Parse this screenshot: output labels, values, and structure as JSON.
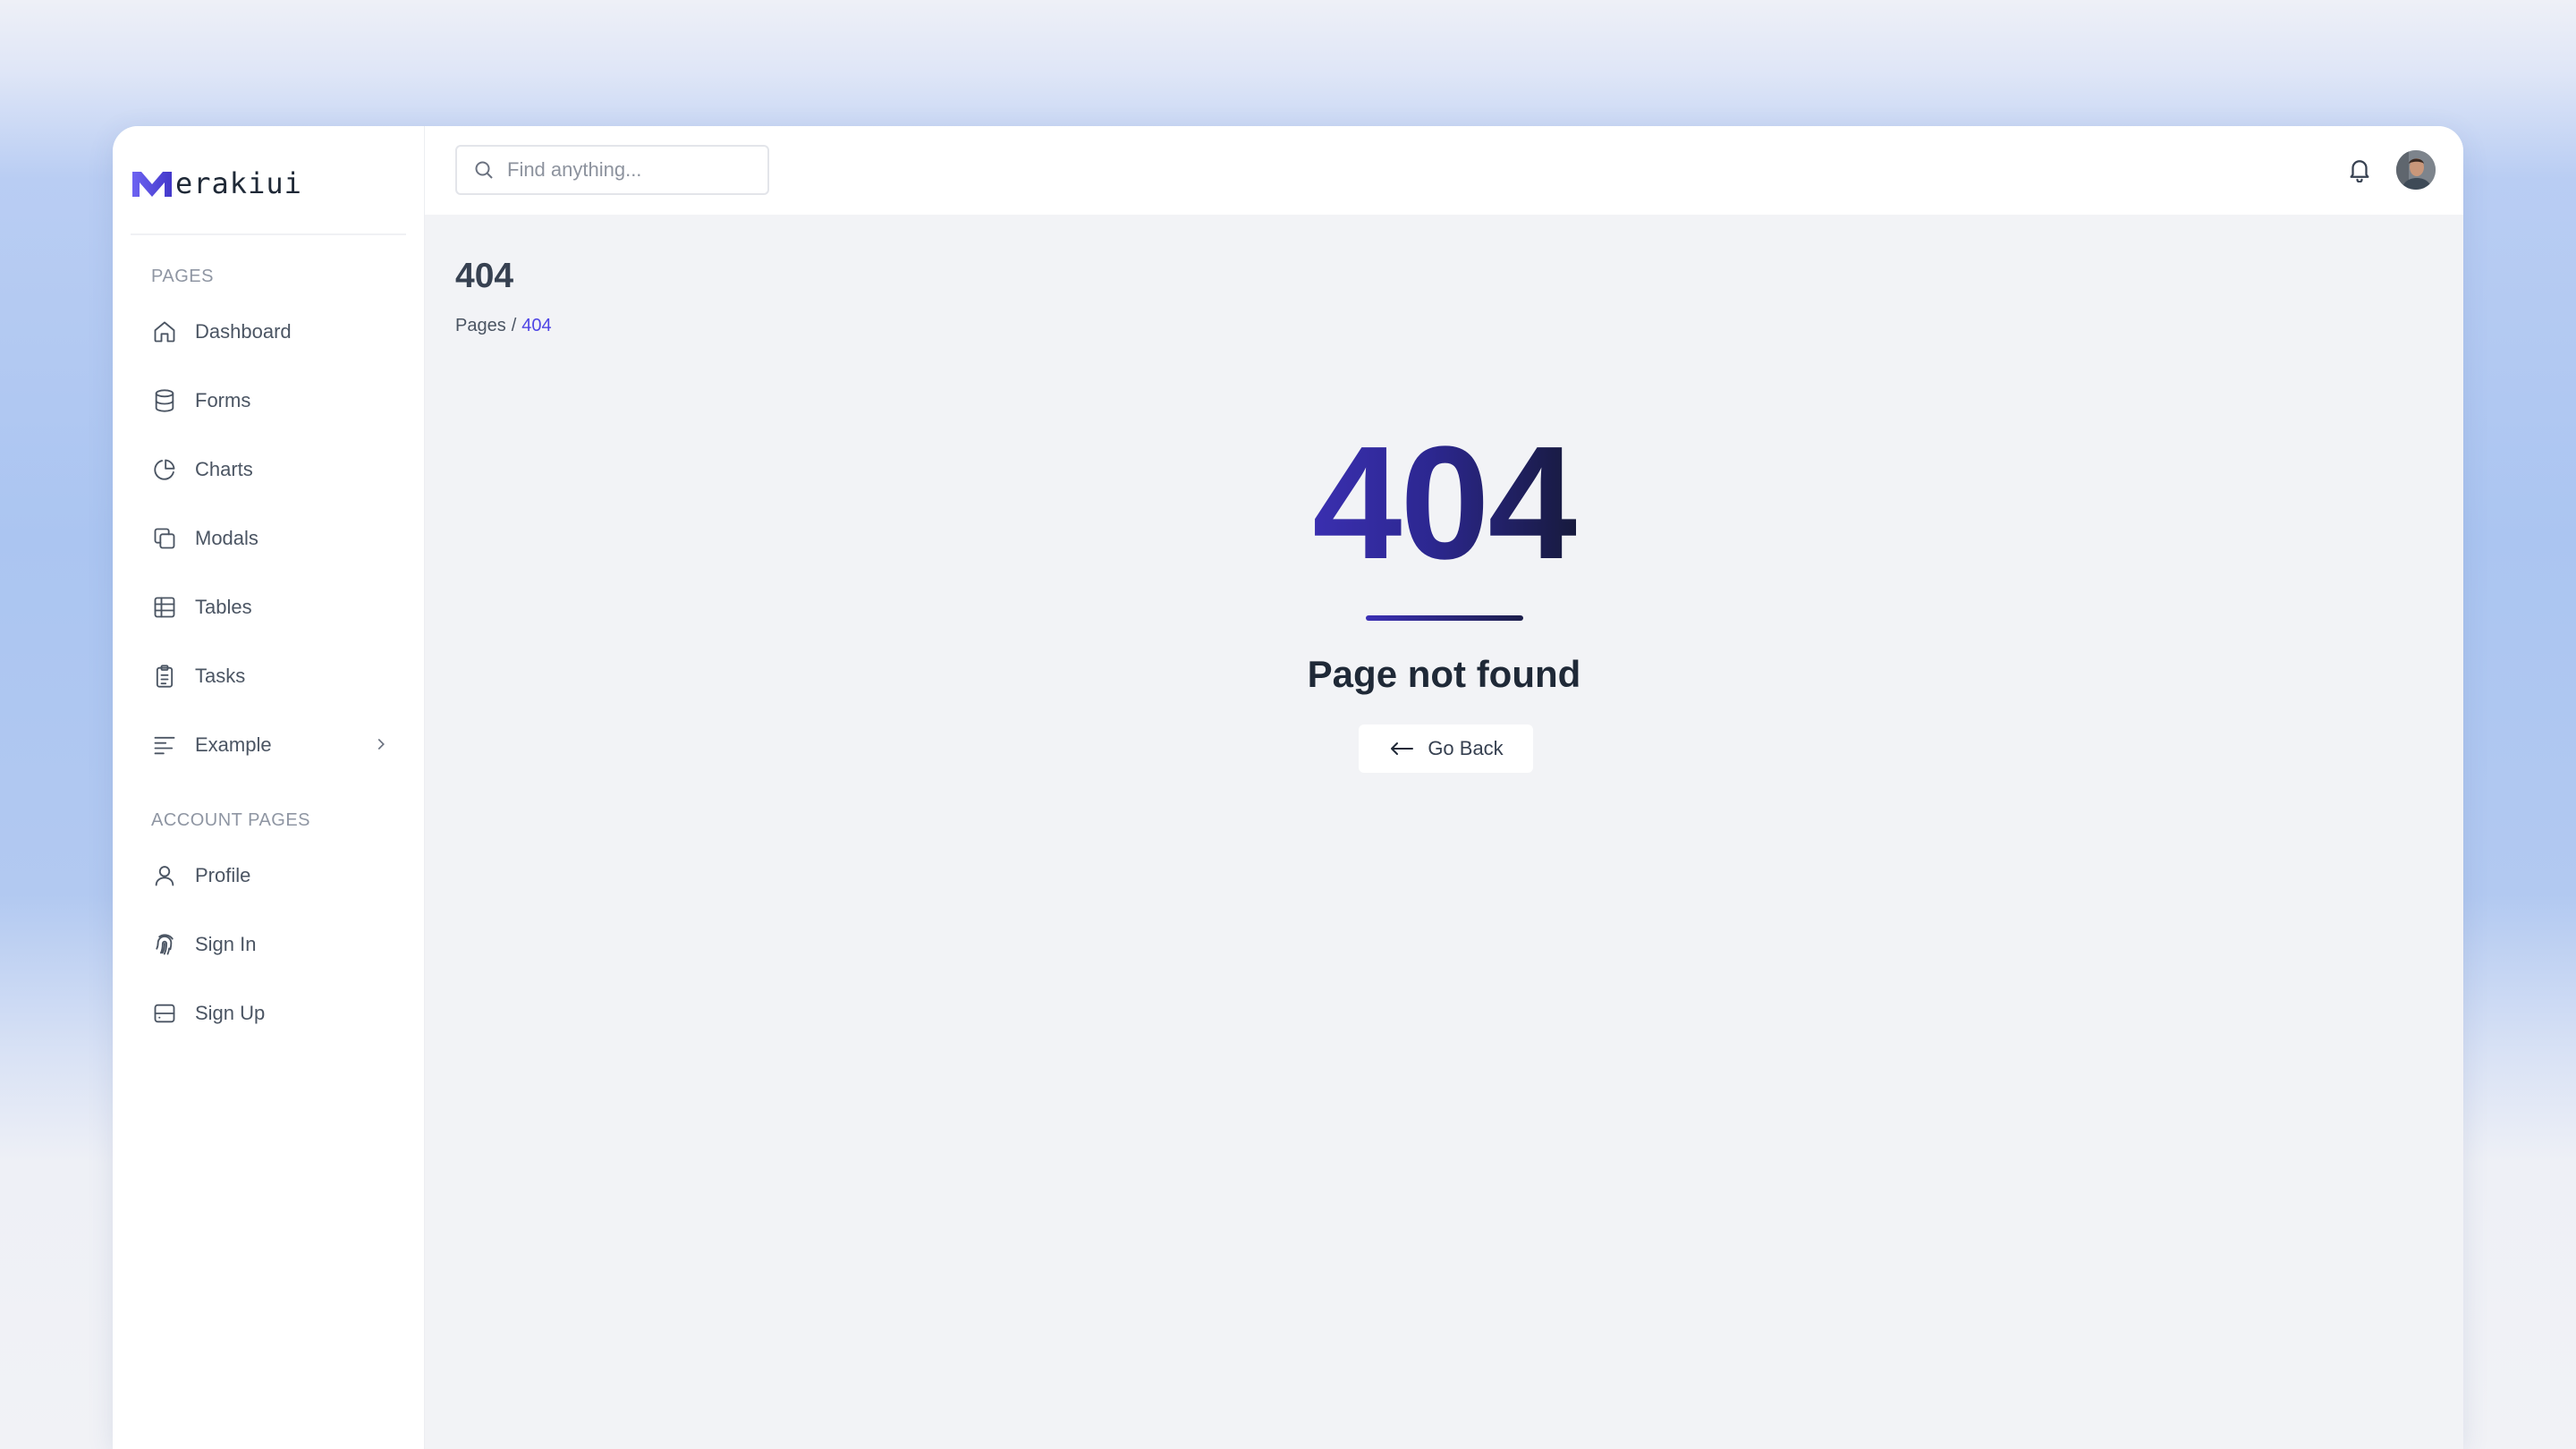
{
  "app": {
    "brand_text": "erakiui",
    "brand_logo_icon": "m-logo-icon",
    "accent_color": "#4f46e5"
  },
  "sidebar": {
    "section_pages": "PAGES",
    "pages_items": [
      {
        "label": "Dashboard",
        "icon": "home-icon"
      },
      {
        "label": "Forms",
        "icon": "database-icon"
      },
      {
        "label": "Charts",
        "icon": "pie-chart-icon"
      },
      {
        "label": "Modals",
        "icon": "copy-icon"
      },
      {
        "label": "Tables",
        "icon": "table-icon"
      },
      {
        "label": "Tasks",
        "icon": "clipboard-icon"
      },
      {
        "label": "Example",
        "icon": "align-left-icon"
      }
    ],
    "section_account": "ACCOUNT PAGES",
    "account_items": [
      {
        "label": "Profile",
        "icon": "user-icon"
      },
      {
        "label": "Sign In",
        "icon": "fingerprint-icon"
      },
      {
        "label": "Sign Up",
        "icon": "server-icon"
      }
    ]
  },
  "topbar": {
    "search_placeholder": "Find anything...",
    "search_value": "",
    "notification_icon": "bell-icon",
    "avatar_icon": "user-avatar"
  },
  "main": {
    "page_title": "404",
    "breadcrumb": {
      "parent": "Pages",
      "separator": "/",
      "current": "404"
    },
    "error_code": "404",
    "error_message": "Page not found",
    "back_button_label": "Go Back"
  }
}
